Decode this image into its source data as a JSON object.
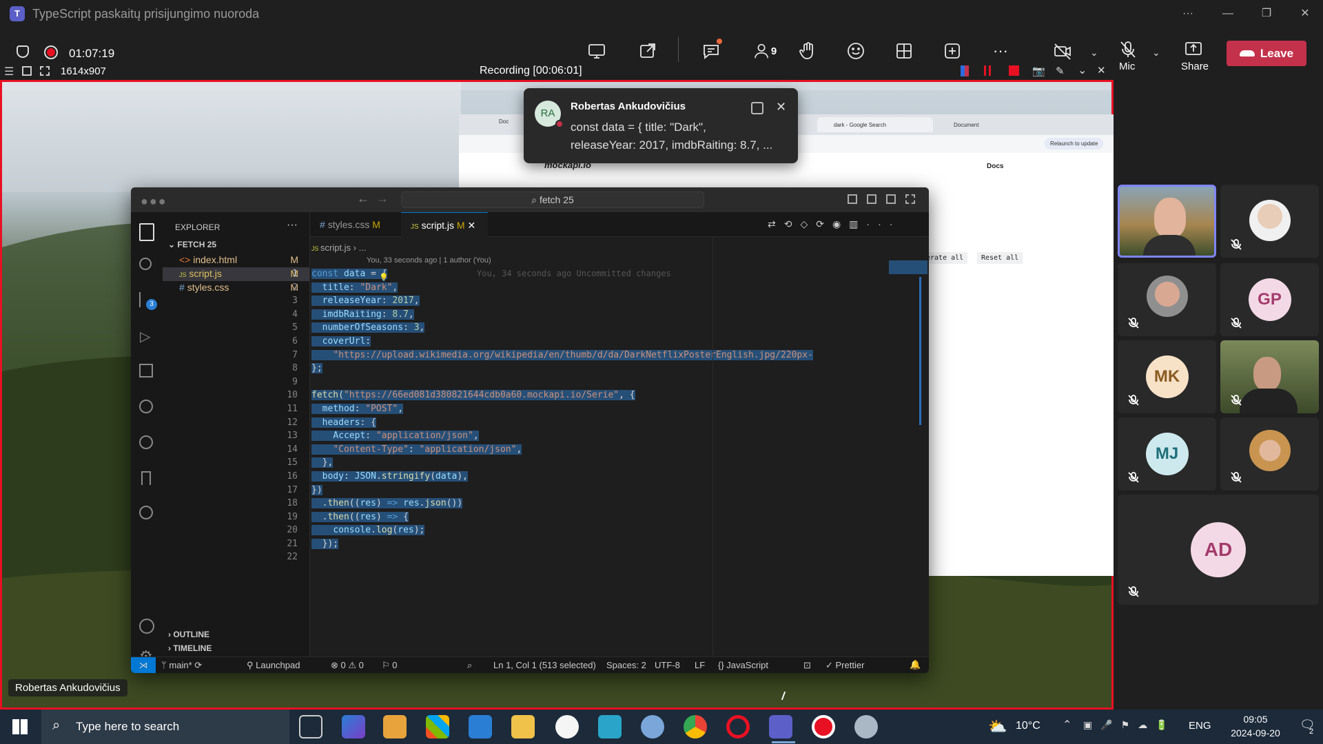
{
  "window": {
    "title": "TypeScript paskaitų prisijungimo nuoroda",
    "app_logo": "T"
  },
  "meeting": {
    "timer": "01:07:19",
    "participants_count": "9",
    "mic_label": "Mic",
    "share_label": "Share",
    "leave_label": "Leave",
    "recording_size": "1614x907",
    "recording_label": "Recording [00:06:01]"
  },
  "toast": {
    "initials": "RA",
    "name": "Robertas Ankudovičius",
    "line1": "const data = {   title: \"Dark\",",
    "line2": "releaseYear: 2017,   imdbRaiting: 8.7,  ..."
  },
  "browser": {
    "tab1": "Doc",
    "tab2": "dark - Google Search",
    "tab3": "Document",
    "relaunch": "Relaunch to update",
    "site_logo": "mockapi.io",
    "docs": "Docs",
    "btn_generate": "erate all",
    "btn_reset": "Reset all"
  },
  "vscode": {
    "search_text": "fetch 25",
    "explorer_label": "EXPLORER",
    "folder": "FETCH 25",
    "files": [
      {
        "name": "index.html",
        "status": "M",
        "icon": "<>"
      },
      {
        "name": "script.js",
        "status": "M",
        "icon": "JS"
      },
      {
        "name": "styles.css",
        "status": "M",
        "icon": "#"
      }
    ],
    "tabs": [
      {
        "name": "styles.css",
        "status": "M",
        "icon": "#"
      },
      {
        "name": "script.js",
        "status": "M",
        "icon": "JS"
      }
    ],
    "breadcrumb_file": "script.js",
    "breadcrumb_rest": "...",
    "blame": "You, 33 seconds ago | 1 author (You)",
    "inline_blame": "You, 34 seconds ago   Uncommitted changes",
    "outline": "OUTLINE",
    "timeline": "TIMELINE",
    "code": [
      [
        {
          "t": "const ",
          "c": "k"
        },
        {
          "t": "data",
          "c": "p"
        },
        {
          "t": " = {",
          "c": "c"
        }
      ],
      [
        {
          "t": "  ",
          "c": "c"
        },
        {
          "t": "title",
          "c": "p"
        },
        {
          "t": ": ",
          "c": "c"
        },
        {
          "t": "\"Dark\"",
          "c": "s"
        },
        {
          "t": ",",
          "c": "c"
        }
      ],
      [
        {
          "t": "  ",
          "c": "c"
        },
        {
          "t": "releaseYear",
          "c": "p"
        },
        {
          "t": ": ",
          "c": "c"
        },
        {
          "t": "2017",
          "c": "n"
        },
        {
          "t": ",",
          "c": "c"
        }
      ],
      [
        {
          "t": "  ",
          "c": "c"
        },
        {
          "t": "imdbRaiting",
          "c": "p"
        },
        {
          "t": ": ",
          "c": "c"
        },
        {
          "t": "8.7",
          "c": "n"
        },
        {
          "t": ",",
          "c": "c"
        }
      ],
      [
        {
          "t": "  ",
          "c": "c"
        },
        {
          "t": "numberOfSeasons",
          "c": "p"
        },
        {
          "t": ": ",
          "c": "c"
        },
        {
          "t": "3",
          "c": "n"
        },
        {
          "t": ",",
          "c": "c"
        }
      ],
      [
        {
          "t": "  ",
          "c": "c"
        },
        {
          "t": "coverUrl",
          "c": "p"
        },
        {
          "t": ":",
          "c": "c"
        }
      ],
      [
        {
          "t": "    ",
          "c": "c"
        },
        {
          "t": "\"https://upload.wikimedia.org/wikipedia/en/thumb/d/da/DarkNetflixPosterEnglish.jpg/220px-",
          "c": "s"
        }
      ],
      [
        {
          "t": "};",
          "c": "c"
        }
      ],
      [
        {
          "t": "",
          "c": "c"
        }
      ],
      [
        {
          "t": "fetch",
          "c": "f"
        },
        {
          "t": "(",
          "c": "c"
        },
        {
          "t": "\"https://66ed081d380821644cdb0a60.mockapi.io/Serie\"",
          "c": "s"
        },
        {
          "t": ", {",
          "c": "c"
        }
      ],
      [
        {
          "t": "  ",
          "c": "c"
        },
        {
          "t": "method",
          "c": "p"
        },
        {
          "t": ": ",
          "c": "c"
        },
        {
          "t": "\"POST\"",
          "c": "s"
        },
        {
          "t": ",",
          "c": "c"
        }
      ],
      [
        {
          "t": "  ",
          "c": "c"
        },
        {
          "t": "headers",
          "c": "p"
        },
        {
          "t": ": {",
          "c": "c"
        }
      ],
      [
        {
          "t": "    ",
          "c": "c"
        },
        {
          "t": "Accept",
          "c": "p"
        },
        {
          "t": ": ",
          "c": "c"
        },
        {
          "t": "\"application/json\"",
          "c": "s"
        },
        {
          "t": ",",
          "c": "c"
        }
      ],
      [
        {
          "t": "    ",
          "c": "c"
        },
        {
          "t": "\"Content-Type\"",
          "c": "s"
        },
        {
          "t": ": ",
          "c": "c"
        },
        {
          "t": "\"application/json\"",
          "c": "s"
        },
        {
          "t": ",",
          "c": "c"
        }
      ],
      [
        {
          "t": "  },",
          "c": "c"
        }
      ],
      [
        {
          "t": "  ",
          "c": "c"
        },
        {
          "t": "body",
          "c": "p"
        },
        {
          "t": ": ",
          "c": "c"
        },
        {
          "t": "JSON",
          "c": "p"
        },
        {
          "t": ".",
          "c": "c"
        },
        {
          "t": "stringify",
          "c": "f"
        },
        {
          "t": "(",
          "c": "c"
        },
        {
          "t": "data",
          "c": "p"
        },
        {
          "t": "),",
          "c": "c"
        }
      ],
      [
        {
          "t": "})",
          "c": "c"
        }
      ],
      [
        {
          "t": "  .",
          "c": "c"
        },
        {
          "t": "then",
          "c": "f"
        },
        {
          "t": "((",
          "c": "c"
        },
        {
          "t": "res",
          "c": "p"
        },
        {
          "t": ") ",
          "c": "c"
        },
        {
          "t": "=>",
          "c": "k"
        },
        {
          "t": " ",
          "c": "c"
        },
        {
          "t": "res",
          "c": "p"
        },
        {
          "t": ".",
          "c": "c"
        },
        {
          "t": "json",
          "c": "f"
        },
        {
          "t": "())",
          "c": "c"
        }
      ],
      [
        {
          "t": "  .",
          "c": "c"
        },
        {
          "t": "then",
          "c": "f"
        },
        {
          "t": "((",
          "c": "c"
        },
        {
          "t": "res",
          "c": "p"
        },
        {
          "t": ") ",
          "c": "c"
        },
        {
          "t": "=>",
          "c": "k"
        },
        {
          "t": " {",
          "c": "c"
        }
      ],
      [
        {
          "t": "    ",
          "c": "c"
        },
        {
          "t": "console",
          "c": "p"
        },
        {
          "t": ".",
          "c": "c"
        },
        {
          "t": "log",
          "c": "f"
        },
        {
          "t": "(",
          "c": "c"
        },
        {
          "t": "res",
          "c": "p"
        },
        {
          "t": ");",
          "c": "c"
        }
      ],
      [
        {
          "t": "  });",
          "c": "c"
        }
      ],
      [
        {
          "t": "",
          "c": "c"
        }
      ]
    ],
    "status": {
      "branch": "main*",
      "launchpad": "Launchpad",
      "errors": "0",
      "warnings": "0",
      "ports": "0",
      "position": "Ln 1, Col 1 (513 selected)",
      "spaces": "Spaces: 2",
      "encoding": "UTF-8",
      "eol": "LF",
      "language": "JavaScript",
      "prettier": "Prettier",
      "scm_badge": "3"
    }
  },
  "presenter_label": "Robertas Ankudovičius",
  "participants": [
    {
      "initials": "GP",
      "color": "#f3d9e6",
      "text_color": "#a33c6b"
    },
    {
      "initials": "MK",
      "color": "#f7e2c8",
      "text_color": "#8a5a1f"
    },
    {
      "initials": "MJ",
      "color": "#cde9ee",
      "text_color": "#1f6f7a"
    },
    {
      "initials": "AD",
      "color": "#f3d9e6",
      "text_color": "#a33c6b"
    }
  ],
  "taskbar": {
    "search_placeholder": "Type here to search",
    "temperature": "10°C",
    "lang": "ENG",
    "time": "09:05",
    "date": "2024-09-20",
    "notif_count": "2"
  }
}
